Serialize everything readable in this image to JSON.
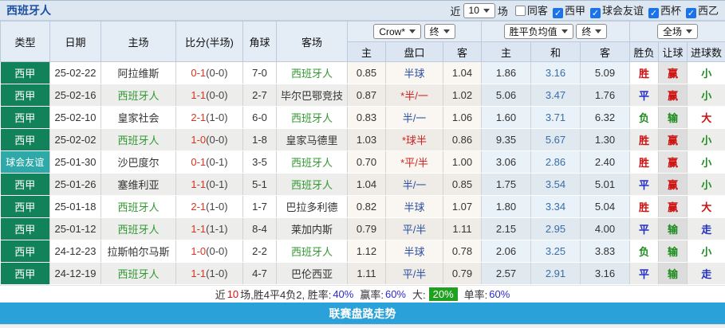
{
  "title": "西班牙人",
  "filters": {
    "recent_label": "近",
    "recent_value": "10",
    "matches_label": "场",
    "checkboxes": [
      {
        "label": "同客",
        "checked": false
      },
      {
        "label": "西甲",
        "checked": true
      },
      {
        "label": "球会友谊",
        "checked": true
      },
      {
        "label": "西杯",
        "checked": true
      },
      {
        "label": "西乙",
        "checked": true
      }
    ]
  },
  "header": {
    "cols": [
      "类型",
      "日期",
      "主场",
      "比分(半场)",
      "角球",
      "客场"
    ],
    "bookmaker_select": "Crow*",
    "bookmaker_time_select": "终",
    "avg_select": "胜平负均值",
    "avg_time_select": "终",
    "scope_select": "全场",
    "sub_cols": [
      "主",
      "盘口",
      "客",
      "主",
      "和",
      "客",
      "胜负",
      "让球",
      "进球数"
    ]
  },
  "rows": [
    {
      "type": "西甲",
      "type_style": "liga",
      "date": "25-02-22",
      "home": "阿拉维斯",
      "home_self": false,
      "score": "0-1",
      "half": "0-0",
      "corner": "7-0",
      "away": "西班牙人",
      "away_self": true,
      "o_home": "0.85",
      "handicap": "半球",
      "hand_red": false,
      "o_away": "1.04",
      "avg_home": "1.86",
      "avg_draw": "3.16",
      "avg_away": "5.09",
      "result": "胜",
      "result_c": "r",
      "letball": "赢",
      "let_c": "r",
      "goals": "小",
      "goal_c": "g"
    },
    {
      "type": "西甲",
      "type_style": "liga",
      "date": "25-02-16",
      "home": "西班牙人",
      "home_self": true,
      "score": "1-1",
      "half": "0-0",
      "corner": "2-7",
      "away": "毕尔巴鄂竞技",
      "away_self": false,
      "o_home": "0.87",
      "handicap": "*半/一",
      "hand_red": true,
      "o_away": "1.02",
      "avg_home": "5.06",
      "avg_draw": "3.47",
      "avg_away": "1.76",
      "result": "平",
      "result_c": "b",
      "letball": "赢",
      "let_c": "r",
      "goals": "小",
      "goal_c": "g"
    },
    {
      "type": "西甲",
      "type_style": "liga",
      "date": "25-02-10",
      "home": "皇家社会",
      "home_self": false,
      "score": "2-1",
      "half": "1-0",
      "corner": "6-0",
      "away": "西班牙人",
      "away_self": true,
      "o_home": "0.83",
      "handicap": "半/一",
      "hand_red": false,
      "o_away": "1.06",
      "avg_home": "1.60",
      "avg_draw": "3.71",
      "avg_away": "6.32",
      "result": "负",
      "result_c": "g",
      "letball": "输",
      "let_c": "g",
      "goals": "大",
      "goal_c": "r"
    },
    {
      "type": "西甲",
      "type_style": "liga",
      "date": "25-02-02",
      "home": "西班牙人",
      "home_self": true,
      "score": "1-0",
      "half": "0-0",
      "corner": "1-8",
      "away": "皇家马德里",
      "away_self": false,
      "o_home": "1.03",
      "handicap": "*球半",
      "hand_red": true,
      "o_away": "0.86",
      "avg_home": "9.35",
      "avg_draw": "5.67",
      "avg_away": "1.30",
      "result": "胜",
      "result_c": "r",
      "letball": "赢",
      "let_c": "r",
      "goals": "小",
      "goal_c": "g"
    },
    {
      "type": "球会友谊",
      "type_style": "friendly",
      "date": "25-01-30",
      "home": "沙巴度尔",
      "home_self": false,
      "score": "0-1",
      "half": "0-1",
      "corner": "3-5",
      "away": "西班牙人",
      "away_self": true,
      "o_home": "0.70",
      "handicap": "*平/半",
      "hand_red": true,
      "o_away": "1.00",
      "avg_home": "3.06",
      "avg_draw": "2.86",
      "avg_away": "2.40",
      "result": "胜",
      "result_c": "r",
      "letball": "赢",
      "let_c": "r",
      "goals": "小",
      "goal_c": "g"
    },
    {
      "type": "西甲",
      "type_style": "liga",
      "date": "25-01-26",
      "home": "塞维利亚",
      "home_self": false,
      "score": "1-1",
      "half": "0-1",
      "corner": "5-1",
      "away": "西班牙人",
      "away_self": true,
      "o_home": "1.04",
      "handicap": "半/一",
      "hand_red": false,
      "o_away": "0.85",
      "avg_home": "1.75",
      "avg_draw": "3.54",
      "avg_away": "5.01",
      "result": "平",
      "result_c": "b",
      "letball": "赢",
      "let_c": "r",
      "goals": "小",
      "goal_c": "g"
    },
    {
      "type": "西甲",
      "type_style": "liga",
      "date": "25-01-18",
      "home": "西班牙人",
      "home_self": true,
      "score": "2-1",
      "half": "1-0",
      "corner": "1-7",
      "away": "巴拉多利德",
      "away_self": false,
      "o_home": "0.82",
      "handicap": "半球",
      "hand_red": false,
      "o_away": "1.07",
      "avg_home": "1.80",
      "avg_draw": "3.34",
      "avg_away": "5.04",
      "result": "胜",
      "result_c": "r",
      "letball": "赢",
      "let_c": "r",
      "goals": "大",
      "goal_c": "r"
    },
    {
      "type": "西甲",
      "type_style": "liga",
      "date": "25-01-12",
      "home": "西班牙人",
      "home_self": true,
      "score": "1-1",
      "half": "1-1",
      "corner": "8-4",
      "away": "莱加内斯",
      "away_self": false,
      "o_home": "0.79",
      "handicap": "平/半",
      "hand_red": false,
      "o_away": "1.11",
      "avg_home": "2.15",
      "avg_draw": "2.95",
      "avg_away": "4.00",
      "result": "平",
      "result_c": "b",
      "letball": "输",
      "let_c": "g",
      "goals": "走",
      "goal_c": "b"
    },
    {
      "type": "西甲",
      "type_style": "liga",
      "date": "24-12-23",
      "home": "拉斯帕尔马斯",
      "home_self": false,
      "score": "1-0",
      "half": "0-0",
      "corner": "2-2",
      "away": "西班牙人",
      "away_self": true,
      "o_home": "1.12",
      "handicap": "半球",
      "hand_red": false,
      "o_away": "0.78",
      "avg_home": "2.06",
      "avg_draw": "3.25",
      "avg_away": "3.83",
      "result": "负",
      "result_c": "g",
      "letball": "输",
      "let_c": "g",
      "goals": "小",
      "goal_c": "g"
    },
    {
      "type": "西甲",
      "type_style": "liga",
      "date": "24-12-19",
      "home": "西班牙人",
      "home_self": true,
      "score": "1-1",
      "half": "1-0",
      "corner": "4-7",
      "away": "巴伦西亚",
      "away_self": false,
      "o_home": "1.11",
      "handicap": "平/半",
      "hand_red": false,
      "o_away": "0.79",
      "avg_home": "2.57",
      "avg_draw": "2.91",
      "avg_away": "3.16",
      "result": "平",
      "result_c": "b",
      "letball": "输",
      "let_c": "g",
      "goals": "走",
      "goal_c": "b"
    }
  ],
  "footer": {
    "pre": "近",
    "count": "10",
    "record": "场,胜4平4负2, 胜率:",
    "win_rate": "40%",
    "let_label": "赢率:",
    "let_rate": "60%",
    "big_label": "大:",
    "big_rate": "20%",
    "single_label": "单率:",
    "single_rate": "60%"
  },
  "bottom_bar": "联赛盘路走势"
}
